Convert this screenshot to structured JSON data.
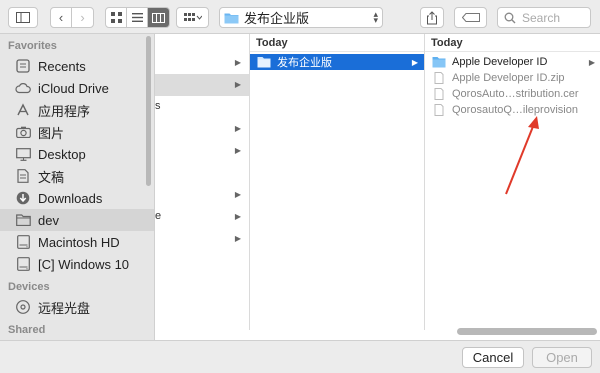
{
  "toolbar": {
    "path_label": "发布企业版",
    "search_placeholder": "Search"
  },
  "sidebar": {
    "favorites_header": "Favorites",
    "favorites": [
      {
        "label": "Recents",
        "icon": "recents-icon"
      },
      {
        "label": "iCloud Drive",
        "icon": "cloud-icon"
      },
      {
        "label": "应用程序",
        "icon": "applications-icon"
      },
      {
        "label": "图片",
        "icon": "camera-icon"
      },
      {
        "label": "Desktop",
        "icon": "desktop-icon"
      },
      {
        "label": "文稿",
        "icon": "document-icon"
      },
      {
        "label": "Downloads",
        "icon": "download-icon"
      },
      {
        "label": "dev",
        "icon": "folder-icon",
        "selected": true
      },
      {
        "label": "Macintosh HD",
        "icon": "disk-icon"
      },
      {
        "label": "[C] Windows 10",
        "icon": "disk-icon"
      }
    ],
    "devices_header": "Devices",
    "devices": [
      {
        "label": "远程光盘",
        "icon": "optical-disc-icon"
      }
    ],
    "shared_header": "Shared"
  },
  "columns": {
    "b_header": "Today",
    "b_items": [
      {
        "label": "发布企业版",
        "selected": true
      }
    ],
    "c_header": "Today",
    "c_items": [
      {
        "label": "Apple Developer ID",
        "type": "folder"
      },
      {
        "label": "Apple Developer ID.zip",
        "type": "file"
      },
      {
        "label": "QorosAuto…stribution.cer",
        "type": "file"
      },
      {
        "label": "QorosautoQ…ileprovision",
        "type": "file"
      }
    ]
  },
  "buttons": {
    "cancel": "Cancel",
    "open": "Open"
  },
  "colors": {
    "selection": "#1a6ed8",
    "folder": "#5fb0f0",
    "annotation_arrow": "#e03a2a"
  }
}
